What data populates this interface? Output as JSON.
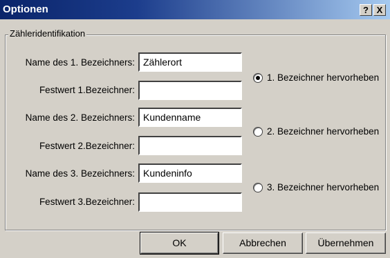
{
  "window": {
    "title": "Optionen",
    "help_label": "?",
    "close_label": "X"
  },
  "group": {
    "label": "Zähleridentifikation",
    "fields": [
      {
        "label": "Name des 1. Bezeichners:",
        "value": "Zählerort"
      },
      {
        "label": "Festwert 1.Bezeichner:",
        "value": ""
      },
      {
        "label": "Name des 2. Bezeichners:",
        "value": "Kundenname"
      },
      {
        "label": "Festwert 2.Bezeichner:",
        "value": ""
      },
      {
        "label": "Name des 3. Bezeichners:",
        "value": "Kundeninfo"
      },
      {
        "label": "Festwert 3.Bezeichner:",
        "value": ""
      }
    ],
    "radios": [
      {
        "label": "1. Bezeichner hervorheben",
        "checked": true
      },
      {
        "label": "2. Bezeichner hervorheben",
        "checked": false
      },
      {
        "label": "3. Bezeichner hervorheben",
        "checked": false
      }
    ]
  },
  "buttons": {
    "ok": "OK",
    "cancel": "Abbrechen",
    "apply": "Übernehmen"
  }
}
